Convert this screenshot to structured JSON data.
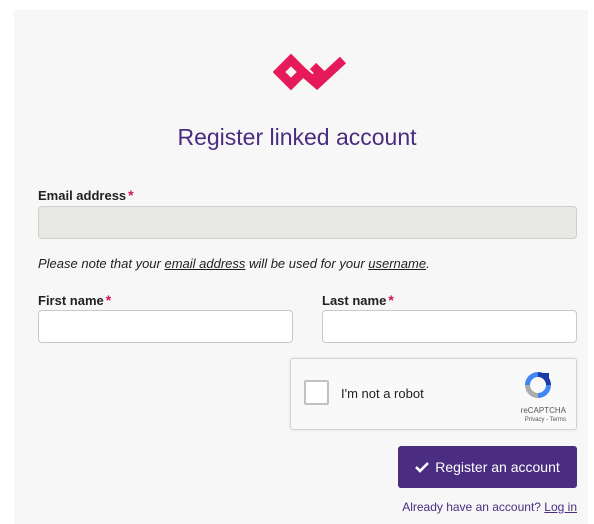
{
  "colors": {
    "brand_purple": "#4a2d80",
    "brand_pink": "#e6195a",
    "required_marker": "#d4145a"
  },
  "logo": {
    "icon": "brand-logo-icon"
  },
  "title": "Register linked account",
  "email": {
    "label": "Email address",
    "required_marker": "*",
    "value": ""
  },
  "note": {
    "prefix": "Please note that your ",
    "email_term": "email address",
    "middle": " will be used for your ",
    "username_term": "username",
    "suffix": "."
  },
  "first_name": {
    "label": "First name",
    "required_marker": "*",
    "value": ""
  },
  "last_name": {
    "label": "Last name",
    "required_marker": "*",
    "value": ""
  },
  "captcha": {
    "label": "I'm not a robot",
    "brand": "reCAPTCHA",
    "links": "Privacy - Terms",
    "icon": "recaptcha-icon"
  },
  "register_button": {
    "label": "Register an account",
    "icon": "checkmark-icon"
  },
  "login": {
    "prompt": "Already have an account?",
    "link": "Log in"
  }
}
